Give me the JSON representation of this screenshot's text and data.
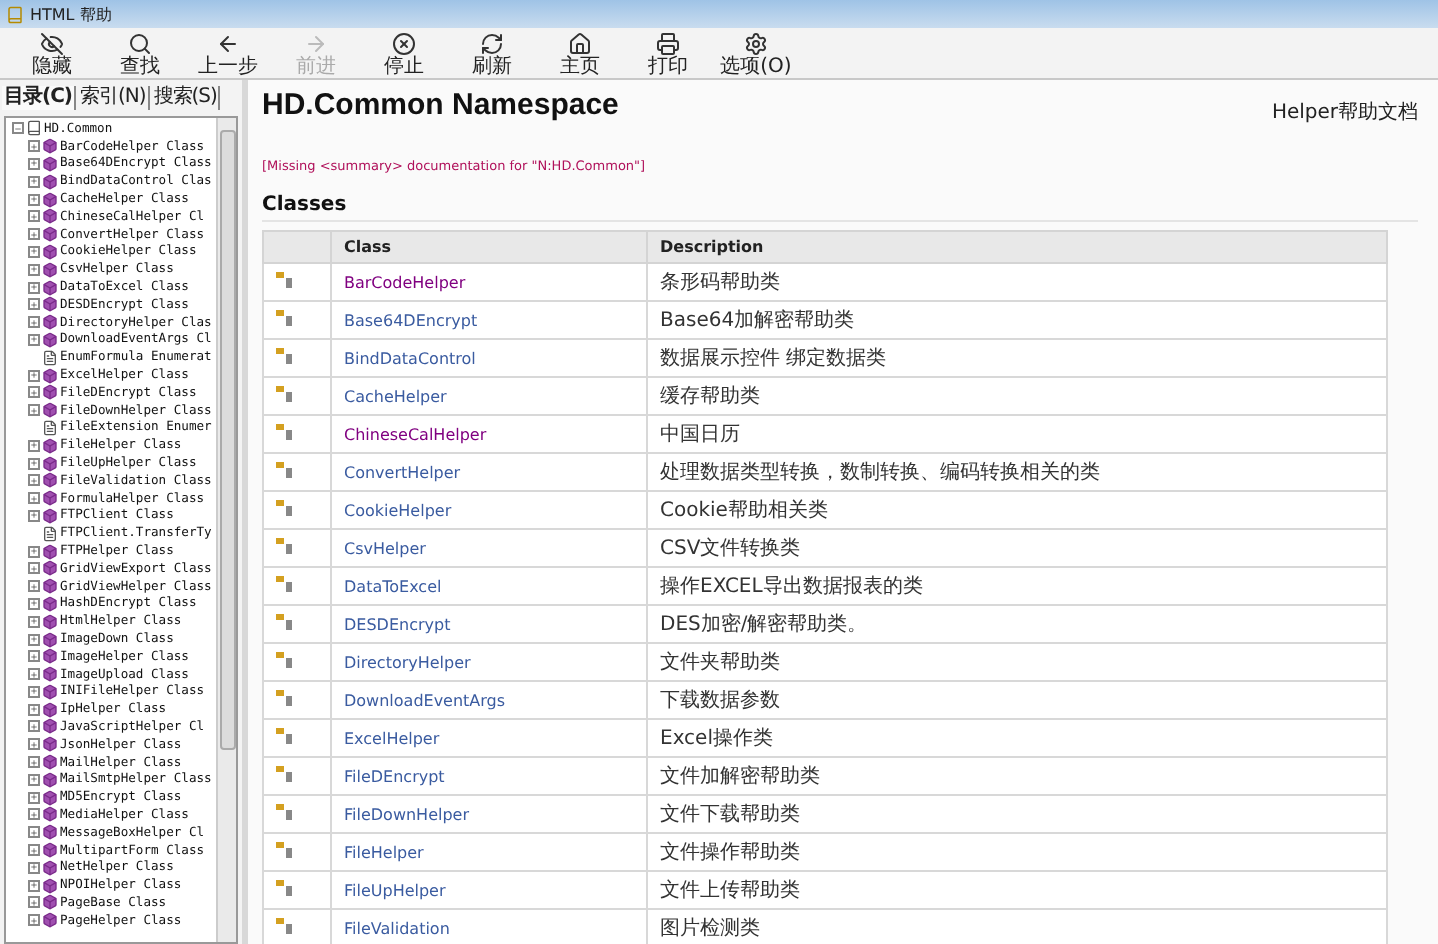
{
  "window": {
    "title": "HTML 帮助"
  },
  "toolbar": [
    {
      "label": "隐藏",
      "disabled": false
    },
    {
      "label": "查找",
      "disabled": false
    },
    {
      "label": "上一步",
      "disabled": false
    },
    {
      "label": "前进",
      "disabled": true
    },
    {
      "label": "停止",
      "disabled": false
    },
    {
      "label": "刷新",
      "disabled": false
    },
    {
      "label": "主页",
      "disabled": false
    },
    {
      "label": "打印",
      "disabled": false
    },
    {
      "label": "选项(O)",
      "disabled": false
    }
  ],
  "tabs": [
    {
      "label": "目录(C)",
      "selected": true
    },
    {
      "label": "索引(N)",
      "selected": false
    },
    {
      "label": "搜索(S)",
      "selected": false
    }
  ],
  "tree": {
    "label": "HD.Common",
    "expanded": true,
    "children": [
      {
        "kind": "class",
        "label": "BarCodeHelper Class",
        "expanded": false
      },
      {
        "kind": "class",
        "label": "Base64DEncrypt Class",
        "expanded": false
      },
      {
        "kind": "class",
        "label": "BindDataControl Clas",
        "expanded": false
      },
      {
        "kind": "class",
        "label": "CacheHelper Class",
        "expanded": false
      },
      {
        "kind": "class",
        "label": "ChineseCalHelper Cl",
        "expanded": false
      },
      {
        "kind": "class",
        "label": "ConvertHelper Class",
        "expanded": false
      },
      {
        "kind": "class",
        "label": "CookieHelper Class",
        "expanded": false
      },
      {
        "kind": "class",
        "label": "CsvHelper Class",
        "expanded": false
      },
      {
        "kind": "class",
        "label": "DataToExcel Class",
        "expanded": false
      },
      {
        "kind": "class",
        "label": "DESDEncrypt Class",
        "expanded": false
      },
      {
        "kind": "class",
        "label": "DirectoryHelper Clas",
        "expanded": false
      },
      {
        "kind": "class",
        "label": "DownloadEventArgs Cl",
        "expanded": false
      },
      {
        "kind": "enum",
        "label": "EnumFormula Enumerat"
      },
      {
        "kind": "class",
        "label": "ExcelHelper Class",
        "expanded": false
      },
      {
        "kind": "class",
        "label": "FileDEncrypt Class",
        "expanded": false
      },
      {
        "kind": "class",
        "label": "FileDownHelper Class",
        "expanded": false
      },
      {
        "kind": "enum",
        "label": "FileExtension Enumer"
      },
      {
        "kind": "class",
        "label": "FileHelper Class",
        "expanded": false
      },
      {
        "kind": "class",
        "label": "FileUpHelper Class",
        "expanded": false
      },
      {
        "kind": "class",
        "label": "FileValidation Class",
        "expanded": false
      },
      {
        "kind": "class",
        "label": "FormulaHelper Class",
        "expanded": false
      },
      {
        "kind": "class",
        "label": "FTPClient Class",
        "expanded": false
      },
      {
        "kind": "enum",
        "label": "FTPClient.TransferTy"
      },
      {
        "kind": "class",
        "label": "FTPHelper Class",
        "expanded": false
      },
      {
        "kind": "class",
        "label": "GridViewExport Class",
        "expanded": false
      },
      {
        "kind": "class",
        "label": "GridViewHelper Class",
        "expanded": false
      },
      {
        "kind": "class",
        "label": "HashDEncrypt Class",
        "expanded": false
      },
      {
        "kind": "class",
        "label": "HtmlHelper Class",
        "expanded": false
      },
      {
        "kind": "class",
        "label": "ImageDown Class",
        "expanded": false
      },
      {
        "kind": "class",
        "label": "ImageHelper Class",
        "expanded": false
      },
      {
        "kind": "class",
        "label": "ImageUpload Class",
        "expanded": false
      },
      {
        "kind": "class",
        "label": "INIFileHelper Class",
        "expanded": false
      },
      {
        "kind": "class",
        "label": "IpHelper Class",
        "expanded": false
      },
      {
        "kind": "class",
        "label": "JavaScriptHelper Cl",
        "expanded": false
      },
      {
        "kind": "class",
        "label": "JsonHelper Class",
        "expanded": false
      },
      {
        "kind": "class",
        "label": "MailHelper Class",
        "expanded": false
      },
      {
        "kind": "class",
        "label": "MailSmtpHelper Class",
        "expanded": false
      },
      {
        "kind": "class",
        "label": "MD5Encrypt Class",
        "expanded": false
      },
      {
        "kind": "class",
        "label": "MediaHelper Class",
        "expanded": false
      },
      {
        "kind": "class",
        "label": "MessageBoxHelper Cl",
        "expanded": false
      },
      {
        "kind": "class",
        "label": "MultipartForm Class",
        "expanded": false
      },
      {
        "kind": "class",
        "label": "NetHelper Class",
        "expanded": false
      },
      {
        "kind": "class",
        "label": "NPOIHelper Class",
        "expanded": false
      },
      {
        "kind": "class",
        "label": "PageBase Class",
        "expanded": false
      },
      {
        "kind": "class",
        "label": "PageHelper Class",
        "expanded": false
      }
    ]
  },
  "page": {
    "title": "HD.Common Namespace",
    "header_right": "Helper帮助文档",
    "missing_note": "[Missing <summary> documentation for \"N:HD.Common\"]",
    "section": "Classes",
    "table": {
      "columns": [
        "Class",
        "Description"
      ],
      "rows": [
        {
          "class": "BarCodeHelper",
          "description": "条形码帮助类",
          "visited": true
        },
        {
          "class": "Base64DEncrypt",
          "description": "Base64加解密帮助类",
          "visited": false
        },
        {
          "class": "BindDataControl",
          "description": "数据展示控件 绑定数据类",
          "visited": false
        },
        {
          "class": "CacheHelper",
          "description": "缓存帮助类",
          "visited": false
        },
        {
          "class": "ChineseCalHelper",
          "description": "中国日历",
          "visited": true
        },
        {
          "class": "ConvertHelper",
          "description": "处理数据类型转换，数制转换、编码转换相关的类",
          "visited": false
        },
        {
          "class": "CookieHelper",
          "description": "Cookie帮助相关类",
          "visited": false
        },
        {
          "class": "CsvHelper",
          "description": "CSV文件转换类",
          "visited": false
        },
        {
          "class": "DataToExcel",
          "description": "操作EXCEL导出数据报表的类",
          "visited": false
        },
        {
          "class": "DESDEncrypt",
          "description": "DES加密/解密帮助类。",
          "visited": false
        },
        {
          "class": "DirectoryHelper",
          "description": "文件夹帮助类",
          "visited": false
        },
        {
          "class": "DownloadEventArgs",
          "description": "下载数据参数",
          "visited": false
        },
        {
          "class": "ExcelHelper",
          "description": "Excel操作类",
          "visited": false
        },
        {
          "class": "FileDEncrypt",
          "description": "文件加解密帮助类",
          "visited": false
        },
        {
          "class": "FileDownHelper",
          "description": "文件下载帮助类",
          "visited": false
        },
        {
          "class": "FileHelper",
          "description": "文件操作帮助类",
          "visited": false
        },
        {
          "class": "FileUpHelper",
          "description": "文件上传帮助类",
          "visited": false
        },
        {
          "class": "FileValidation",
          "description": "图片检测类",
          "visited": false
        }
      ]
    }
  }
}
